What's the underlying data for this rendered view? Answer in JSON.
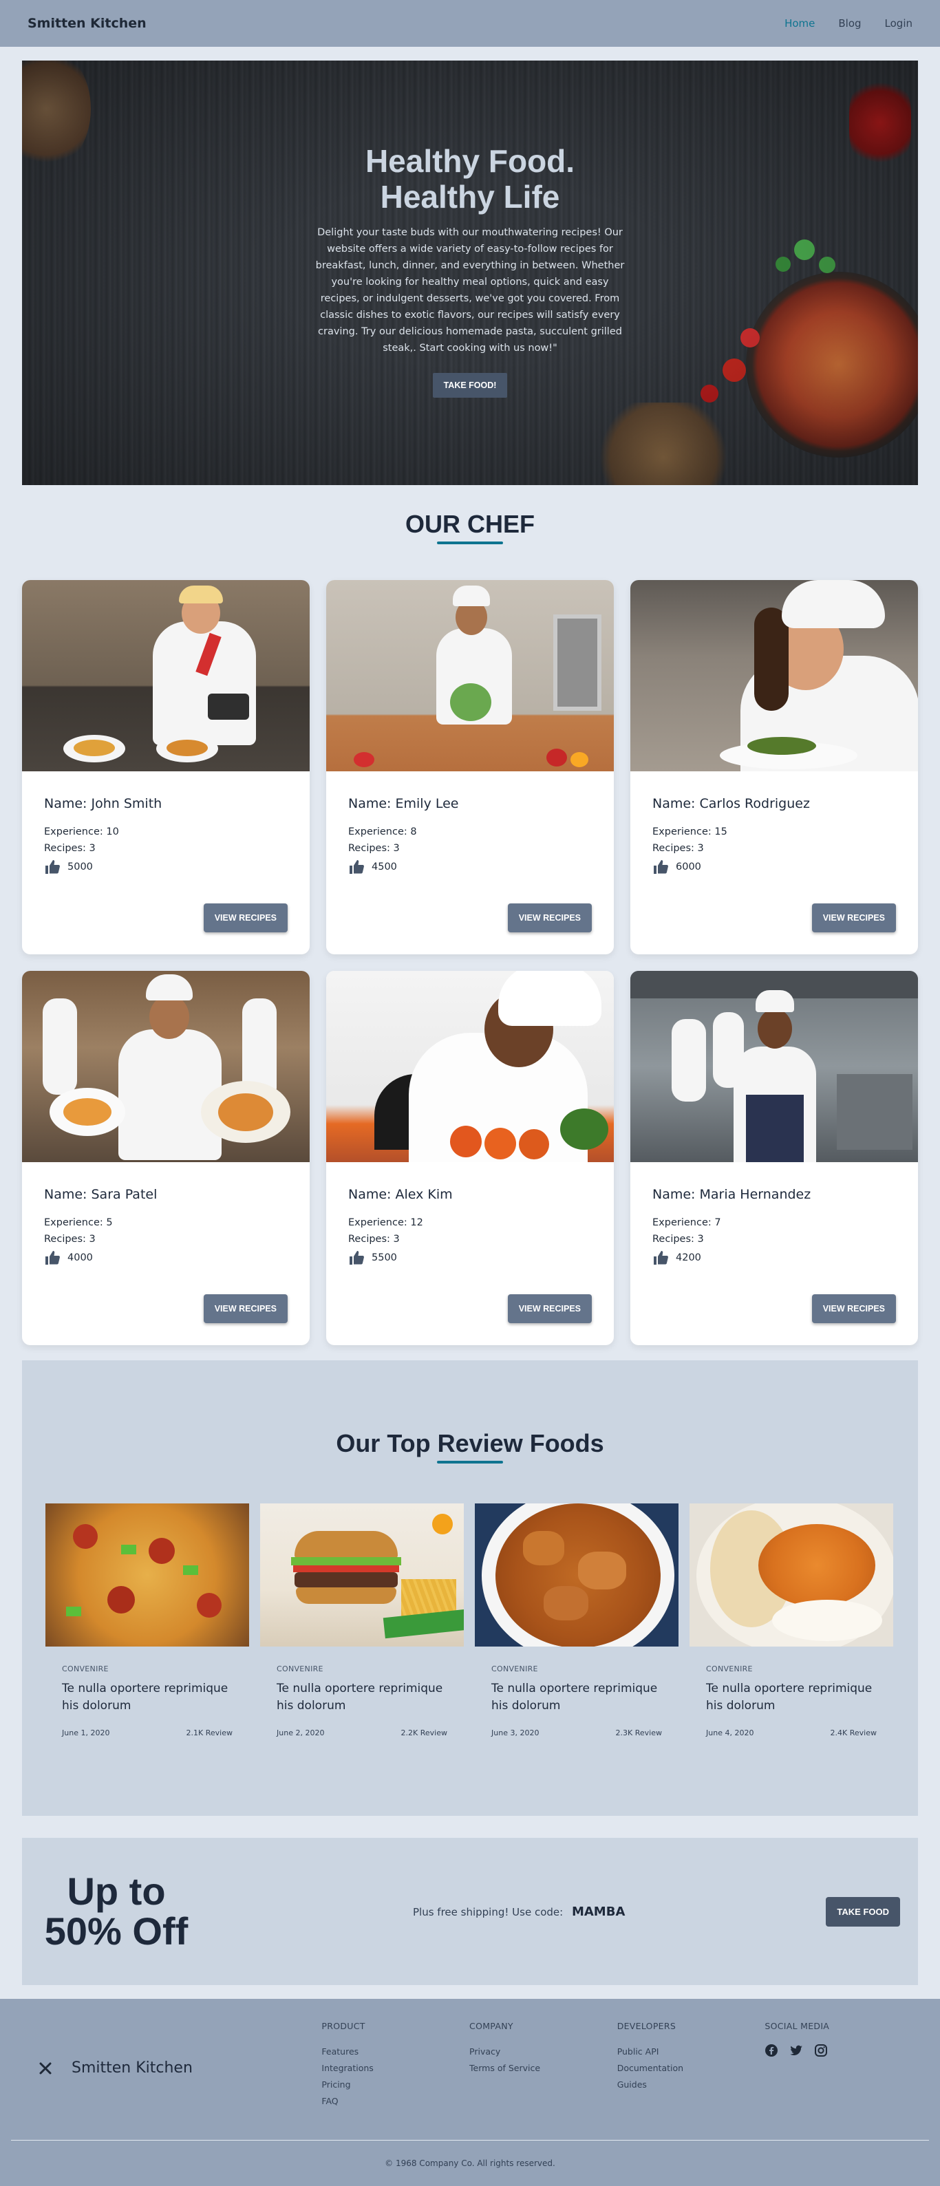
{
  "nav": {
    "brand": "Smitten Kitchen",
    "links": [
      "Home",
      "Blog",
      "Login"
    ]
  },
  "hero": {
    "title_line1": "Healthy Food.",
    "title_line2": "Healthy Life",
    "text": "Delight your taste buds with our mouthwatering recipes! Our website offers a wide variety of easy-to-follow recipes for breakfast, lunch, dinner, and everything in between. Whether you're looking for healthy meal options, quick and easy recipes, or indulgent desserts, we've got you covered. From classic dishes to exotic flavors, our recipes will satisfy every craving. Try our delicious homemade pasta, succulent grilled steak,. Start cooking with us now!\"",
    "button": "TAKE FOOD!"
  },
  "chefs": {
    "title": "OUR CHEF",
    "experience_label": "Experience: ",
    "recipes_label": "Recipes: ",
    "button": "VIEW RECIPES",
    "items": [
      {
        "name": "Name: John Smith",
        "experience": "Experience: 10",
        "recipes": "Recipes: 3",
        "likes": "5000"
      },
      {
        "name": "Name: Emily Lee",
        "experience": "Experience: 8",
        "recipes": "Recipes: 3",
        "likes": "4500"
      },
      {
        "name": "Name: Carlos Rodriguez",
        "experience": "Experience: 15",
        "recipes": "Recipes: 3",
        "likes": "6000"
      },
      {
        "name": "Name: Sara Patel",
        "experience": "Experience: 5",
        "recipes": "Recipes: 3",
        "likes": "4000"
      },
      {
        "name": "Name: Alex Kim",
        "experience": "Experience: 12",
        "recipes": "Recipes: 3",
        "likes": "5500"
      },
      {
        "name": "Name: Maria Hernandez",
        "experience": "Experience: 7",
        "recipes": "Recipes: 3",
        "likes": "4200"
      }
    ]
  },
  "reviews": {
    "title_part1": "Our Top ",
    "title_part2": "Review",
    "title_part3": " Foods",
    "items": [
      {
        "category": "CONVENIRE",
        "title": "Te nulla oportere reprimique his dolorum",
        "date": "June 1, 2020",
        "reviews": "2.1K Review"
      },
      {
        "category": "CONVENIRE",
        "title": "Te nulla oportere reprimique his dolorum",
        "date": "June 2, 2020",
        "reviews": "2.2K Review"
      },
      {
        "category": "CONVENIRE",
        "title": "Te nulla oportere reprimique his dolorum",
        "date": "June 3, 2020",
        "reviews": "2.3K Review"
      },
      {
        "category": "CONVENIRE",
        "title": "Te nulla oportere reprimique his dolorum",
        "date": "June 4, 2020",
        "reviews": "2.4K Review"
      }
    ]
  },
  "promo": {
    "big_line1": "Up to",
    "big_line2": "50% Off",
    "text": "Plus free shipping! Use code:",
    "code": "MAMBA",
    "button": "TAKE FOOD"
  },
  "footer": {
    "brand": "Smitten Kitchen",
    "columns": [
      {
        "title": "PRODUCT",
        "links": [
          "Features",
          "Integrations",
          "Pricing",
          "FAQ"
        ]
      },
      {
        "title": "COMPANY",
        "links": [
          "Privacy",
          "Terms of Service"
        ]
      },
      {
        "title": "DEVELOPERS",
        "links": [
          "Public API",
          "Documentation",
          "Guides"
        ]
      }
    ],
    "social_title": "SOCIAL MEDIA",
    "social_icons": [
      "facebook-icon",
      "twitter-icon",
      "instagram-icon"
    ],
    "copyright": "© 1968 Company Co. All rights reserved."
  },
  "colors": {
    "nav_bg": "#94a3b8",
    "page_bg": "#e2e8f0",
    "accent": "#0e7490",
    "button": "#475569"
  }
}
